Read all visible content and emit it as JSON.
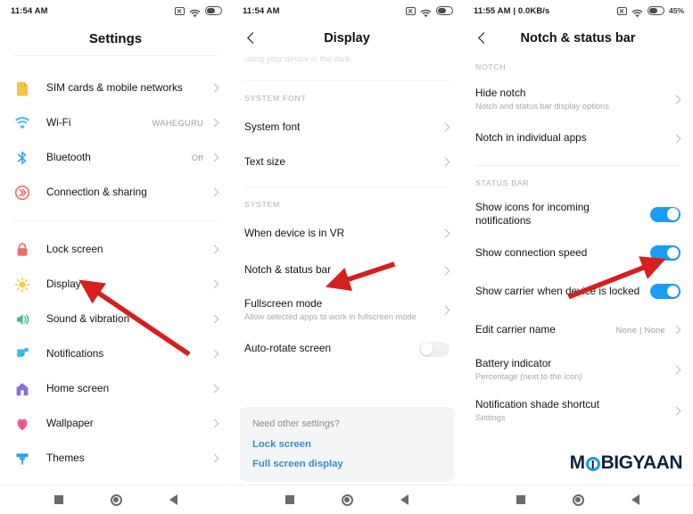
{
  "panel1": {
    "statusbar": {
      "time": "11:54 AM",
      "icons": [
        "x-mark-icon",
        "wifi-icon",
        "battery-icon"
      ]
    },
    "title": "Settings",
    "items": [
      {
        "label": "SIM cards & mobile networks",
        "value": "",
        "icon": "sim-card-icon",
        "color": "#f6c445"
      },
      {
        "label": "Wi-Fi",
        "value": "WAHEGURU",
        "icon": "wifi-icon",
        "color": "#4ab6e8"
      },
      {
        "label": "Bluetooth",
        "value": "Off",
        "icon": "bluetooth-icon",
        "color": "#2e9ff0"
      },
      {
        "label": "Connection & sharing",
        "value": "",
        "icon": "connection-sharing-icon",
        "color": "#ef6b6b"
      },
      {
        "label": "Lock screen",
        "value": "",
        "icon": "lock-icon",
        "color": "#ef6b6b"
      },
      {
        "label": "Display",
        "value": "",
        "icon": "brightness-sun-icon",
        "color": "#f7c948"
      },
      {
        "label": "Sound & vibration",
        "value": "",
        "icon": "speaker-icon",
        "color": "#3fc07e"
      },
      {
        "label": "Notifications",
        "value": "",
        "icon": "notifications-icon",
        "color": "#3eb9ef"
      },
      {
        "label": "Home screen",
        "value": "",
        "icon": "home-icon",
        "color": "#8a6fd6"
      },
      {
        "label": "Wallpaper",
        "value": "",
        "icon": "wallpaper-flower-icon",
        "color": "#ef5f93"
      },
      {
        "label": "Themes",
        "value": "",
        "icon": "themes-brush-icon",
        "color": "#2e9ff0"
      }
    ]
  },
  "panel2": {
    "statusbar": {
      "time": "11:54 AM"
    },
    "title": "Display",
    "clipped_text": "using your device in the dark.",
    "sections": [
      {
        "header": "SYSTEM FONT",
        "items": [
          {
            "label": "System font",
            "sub": "",
            "type": "chevron"
          },
          {
            "label": "Text size",
            "sub": "",
            "type": "chevron"
          }
        ]
      },
      {
        "header": "SYSTEM",
        "items": [
          {
            "label": "When device is in VR",
            "sub": "",
            "type": "chevron"
          },
          {
            "label": "Notch & status bar",
            "sub": "",
            "type": "chevron"
          },
          {
            "label": "Fullscreen mode",
            "sub": "Allow selected apps to work in fullscreen mode",
            "type": "chevron"
          },
          {
            "label": "Auto-rotate screen",
            "sub": "",
            "type": "toggle",
            "toggle": "off"
          }
        ]
      }
    ],
    "card": {
      "question": "Need other settings?",
      "links": [
        "Lock screen",
        "Full screen display"
      ]
    }
  },
  "panel3": {
    "statusbar": {
      "time": "11:55 AM | 0.0KB/s",
      "battery_text": "45%"
    },
    "title": "Notch & status bar",
    "sections": [
      {
        "header": "NOTCH",
        "items": [
          {
            "label": "Hide notch",
            "sub": "Notch and status bar display options",
            "type": "chevron"
          },
          {
            "label": "Notch in individual apps",
            "sub": "",
            "type": "chevron"
          }
        ]
      },
      {
        "header": "STATUS BAR",
        "items": [
          {
            "label": "Show icons for incoming notifications",
            "sub": "",
            "type": "toggle",
            "toggle": "on"
          },
          {
            "label": "Show connection speed",
            "sub": "",
            "type": "toggle",
            "toggle": "on"
          },
          {
            "label": "Show carrier when device is locked",
            "sub": "",
            "type": "toggle",
            "toggle": "on"
          },
          {
            "label": "Edit carrier name",
            "sub": "",
            "value": "None | None",
            "type": "chevron"
          },
          {
            "label": "Battery indicator",
            "sub": "Percentage (next to the icon)",
            "type": "chevron"
          },
          {
            "label": "Notification shade shortcut",
            "sub": "Settings",
            "type": "chevron"
          }
        ]
      }
    ],
    "watermark": {
      "text_before": "M",
      "text_after": "BIGYAAN"
    }
  },
  "navbar": {
    "items": [
      "recents-square-icon",
      "home-circle-icon",
      "back-triangle-icon"
    ]
  },
  "annotations": {
    "arrow_color": "#d61f1f",
    "arrows": [
      {
        "target": "Display",
        "panel": 1
      },
      {
        "target": "Notch & status bar",
        "panel": 2
      },
      {
        "target": "Show connection speed toggle",
        "panel": 3
      }
    ]
  },
  "colors": {
    "accent_blue": "#1a9ef5",
    "link_blue": "#3390c9",
    "arrow_red": "#d61f1f"
  }
}
